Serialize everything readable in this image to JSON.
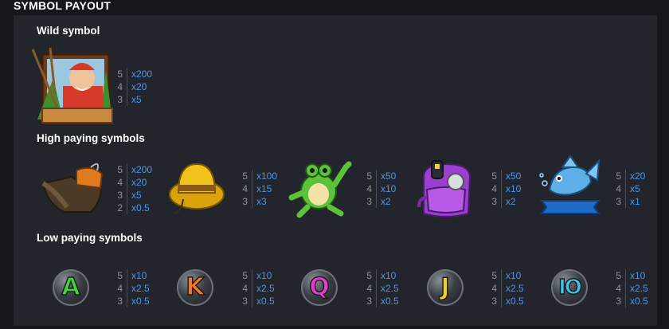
{
  "header": {
    "title": "SYMBOL PAYOUT"
  },
  "sections": {
    "wild": "Wild symbol",
    "high": "High paying symbols",
    "low": "Low paying symbols"
  },
  "wild_symbol": {
    "icon": "fisherman-icon",
    "counts": [
      "5",
      "4",
      "3"
    ],
    "mults": [
      "x200",
      "x20",
      "x5"
    ]
  },
  "high_symbols": [
    {
      "icon": "boot-icon",
      "counts": [
        "5",
        "4",
        "3",
        "2"
      ],
      "mults": [
        "x200",
        "x20",
        "x5",
        "x0.5"
      ]
    },
    {
      "icon": "hat-icon",
      "counts": [
        "5",
        "4",
        "3"
      ],
      "mults": [
        "x100",
        "x15",
        "x3"
      ]
    },
    {
      "icon": "frog-icon",
      "counts": [
        "5",
        "4",
        "3"
      ],
      "mults": [
        "x50",
        "x10",
        "x2"
      ]
    },
    {
      "icon": "backpack-icon",
      "counts": [
        "5",
        "4",
        "3"
      ],
      "mults": [
        "x50",
        "x10",
        "x2"
      ]
    },
    {
      "icon": "fish-icon",
      "counts": [
        "5",
        "4",
        "3"
      ],
      "mults": [
        "x20",
        "x5",
        "x1"
      ]
    }
  ],
  "low_symbols": [
    {
      "letter": "A",
      "color": "#3fd63a",
      "counts": [
        "5",
        "4",
        "3"
      ],
      "mults": [
        "x10",
        "x2.5",
        "x0.5"
      ]
    },
    {
      "letter": "K",
      "color": "#f07a2a",
      "counts": [
        "5",
        "4",
        "3"
      ],
      "mults": [
        "x10",
        "x2.5",
        "x0.5"
      ]
    },
    {
      "letter": "Q",
      "color": "#e83bd6",
      "counts": [
        "5",
        "4",
        "3"
      ],
      "mults": [
        "x10",
        "x2.5",
        "x0.5"
      ]
    },
    {
      "letter": "J",
      "color": "#f2d21e",
      "counts": [
        "5",
        "4",
        "3"
      ],
      "mults": [
        "x10",
        "x2.5",
        "x0.5"
      ]
    },
    {
      "letter": "IO",
      "color": "#3ec6f0",
      "counts": [
        "5",
        "4",
        "3"
      ],
      "mults": [
        "x10",
        "x2.5",
        "x0.5"
      ]
    }
  ]
}
